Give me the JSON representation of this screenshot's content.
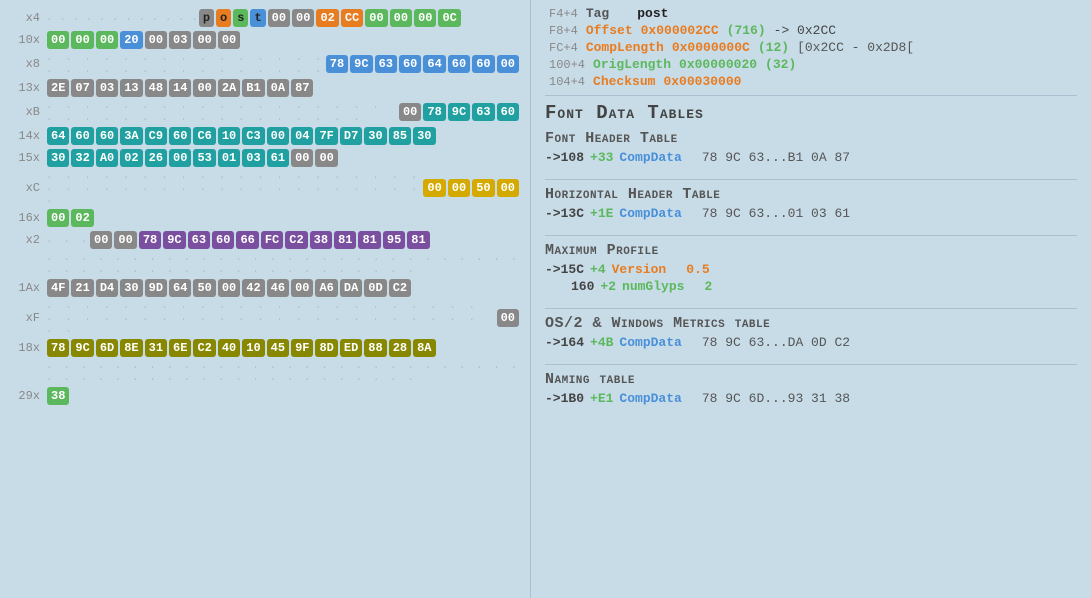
{
  "left": {
    "rows": [
      {
        "label": "x4",
        "prefix_dots": true,
        "cells": [
          {
            "val": "p",
            "cls": "post-p"
          },
          {
            "val": "o",
            "cls": "post-o"
          },
          {
            "val": "s",
            "cls": "post-s"
          },
          {
            "val": "t",
            "cls": "post-t"
          },
          {
            "val": "00",
            "cls": "hc-gray"
          },
          {
            "val": "00",
            "cls": "hc-gray"
          },
          {
            "val": "02",
            "cls": "hc-orange"
          },
          {
            "val": "CC",
            "cls": "hc-orange"
          },
          {
            "val": "00",
            "cls": "hc-green"
          },
          {
            "val": "00",
            "cls": "hc-green"
          },
          {
            "val": "00",
            "cls": "hc-green"
          },
          {
            "val": "0C",
            "cls": "hc-green"
          }
        ]
      },
      {
        "label": "10x",
        "prefix_dots": false,
        "cells": [
          {
            "val": "00",
            "cls": "hc-green"
          },
          {
            "val": "00",
            "cls": "hc-green"
          },
          {
            "val": "00",
            "cls": "hc-green"
          },
          {
            "val": "20",
            "cls": "hc-blue"
          },
          {
            "val": "00",
            "cls": "hc-gray"
          },
          {
            "val": "03",
            "cls": "hc-gray"
          },
          {
            "val": "00",
            "cls": "hc-gray"
          },
          {
            "val": "00",
            "cls": "hc-gray"
          }
        ]
      },
      {
        "label": "x8",
        "prefix_dots": true,
        "prefix_long": true,
        "cells": [
          {
            "val": "78",
            "cls": "hc-blue"
          },
          {
            "val": "9C",
            "cls": "hc-blue"
          },
          {
            "val": "63",
            "cls": "hc-blue"
          },
          {
            "val": "60",
            "cls": "hc-blue"
          },
          {
            "val": "64",
            "cls": "hc-blue"
          },
          {
            "val": "60",
            "cls": "hc-blue"
          },
          {
            "val": "60",
            "cls": "hc-blue"
          },
          {
            "val": "00",
            "cls": "hc-blue"
          }
        ]
      },
      {
        "label": "13x",
        "prefix_dots": false,
        "cells": [
          {
            "val": "2E",
            "cls": "hc-gray"
          },
          {
            "val": "07",
            "cls": "hc-gray"
          },
          {
            "val": "03",
            "cls": "hc-gray"
          },
          {
            "val": "13",
            "cls": "hc-gray"
          },
          {
            "val": "48",
            "cls": "hc-gray"
          },
          {
            "val": "14",
            "cls": "hc-gray"
          },
          {
            "val": "00",
            "cls": "hc-gray"
          },
          {
            "val": "2A",
            "cls": "hc-gray"
          },
          {
            "val": "B1",
            "cls": "hc-gray"
          },
          {
            "val": "0A",
            "cls": "hc-gray"
          },
          {
            "val": "87",
            "cls": "hc-gray"
          }
        ]
      },
      {
        "label": "xB",
        "prefix_dots": true,
        "prefix_long": true,
        "before_cells": [
          {
            "val": "00",
            "cls": "hc-gray"
          }
        ],
        "cells": [
          {
            "val": "78",
            "cls": "hc-teal"
          },
          {
            "val": "9C",
            "cls": "hc-teal"
          },
          {
            "val": "63",
            "cls": "hc-teal"
          },
          {
            "val": "60",
            "cls": "hc-teal"
          }
        ]
      },
      {
        "label": "14x",
        "prefix_dots": false,
        "cells": [
          {
            "val": "64",
            "cls": "hc-teal"
          },
          {
            "val": "60",
            "cls": "hc-teal"
          },
          {
            "val": "60",
            "cls": "hc-teal"
          },
          {
            "val": "3A",
            "cls": "hc-teal"
          },
          {
            "val": "C9",
            "cls": "hc-teal"
          },
          {
            "val": "60",
            "cls": "hc-teal"
          },
          {
            "val": "C6",
            "cls": "hc-teal"
          },
          {
            "val": "10",
            "cls": "hc-teal"
          },
          {
            "val": "C3",
            "cls": "hc-teal"
          },
          {
            "val": "00",
            "cls": "hc-teal"
          },
          {
            "val": "04",
            "cls": "hc-teal"
          },
          {
            "val": "7F",
            "cls": "hc-teal"
          },
          {
            "val": "D7",
            "cls": "hc-teal"
          },
          {
            "val": "30",
            "cls": "hc-teal"
          },
          {
            "val": "85",
            "cls": "hc-teal"
          },
          {
            "val": "30",
            "cls": "hc-teal"
          }
        ]
      },
      {
        "label": "15x",
        "prefix_dots": false,
        "cells": [
          {
            "val": "30",
            "cls": "hc-teal"
          },
          {
            "val": "32",
            "cls": "hc-teal"
          },
          {
            "val": "A0",
            "cls": "hc-teal"
          },
          {
            "val": "02",
            "cls": "hc-teal"
          },
          {
            "val": "26",
            "cls": "hc-teal"
          },
          {
            "val": "00",
            "cls": "hc-teal"
          },
          {
            "val": "53",
            "cls": "hc-teal"
          },
          {
            "val": "01",
            "cls": "hc-teal"
          },
          {
            "val": "03",
            "cls": "hc-teal"
          },
          {
            "val": "61",
            "cls": "hc-teal"
          },
          {
            "val": "00",
            "cls": "hc-gray"
          },
          {
            "val": "00",
            "cls": "hc-gray"
          }
        ]
      },
      {
        "label": "xC",
        "prefix_dots": true,
        "prefix_long": true,
        "cells": [
          {
            "val": "00",
            "cls": "hc-yellow"
          },
          {
            "val": "00",
            "cls": "hc-yellow"
          },
          {
            "val": "50",
            "cls": "hc-yellow"
          },
          {
            "val": "00",
            "cls": "hc-yellow"
          }
        ]
      },
      {
        "label": "16x",
        "prefix_dots": false,
        "cells": [
          {
            "val": "00",
            "cls": "hc-green"
          },
          {
            "val": "02",
            "cls": "hc-green"
          }
        ]
      },
      {
        "label": "x2",
        "prefix_dots": true,
        "cells": [
          {
            "val": "00",
            "cls": "hc-gray"
          },
          {
            "val": "00",
            "cls": "hc-gray"
          },
          {
            "val": "78",
            "cls": "hc-purple"
          },
          {
            "val": "9C",
            "cls": "hc-purple"
          },
          {
            "val": "63",
            "cls": "hc-purple"
          },
          {
            "val": "60",
            "cls": "hc-purple"
          },
          {
            "val": "66",
            "cls": "hc-purple"
          },
          {
            "val": "FC",
            "cls": "hc-purple"
          },
          {
            "val": "C2",
            "cls": "hc-purple"
          },
          {
            "val": "38",
            "cls": "hc-purple"
          },
          {
            "val": "81",
            "cls": "hc-purple"
          },
          {
            "val": "81",
            "cls": "hc-purple"
          },
          {
            "val": "95",
            "cls": "hc-purple"
          },
          {
            "val": "81",
            "cls": "hc-purple"
          }
        ]
      },
      {
        "label": "",
        "prefix_dots": false,
        "cells": []
      },
      {
        "label": "1Ax",
        "prefix_dots": false,
        "cells": [
          {
            "val": "4F",
            "cls": "hc-gray"
          },
          {
            "val": "21",
            "cls": "hc-gray"
          },
          {
            "val": "D4",
            "cls": "hc-gray"
          },
          {
            "val": "30",
            "cls": "hc-gray"
          },
          {
            "val": "9D",
            "cls": "hc-gray"
          },
          {
            "val": "64",
            "cls": "hc-gray"
          },
          {
            "val": "50",
            "cls": "hc-gray"
          },
          {
            "val": "00",
            "cls": "hc-gray"
          },
          {
            "val": "42",
            "cls": "hc-gray"
          },
          {
            "val": "46",
            "cls": "hc-gray"
          },
          {
            "val": "00",
            "cls": "hc-gray"
          },
          {
            "val": "A6",
            "cls": "hc-gray"
          },
          {
            "val": "DA",
            "cls": "hc-gray"
          },
          {
            "val": "0D",
            "cls": "hc-gray"
          },
          {
            "val": "C2",
            "cls": "hc-gray"
          }
        ]
      },
      {
        "label": "xF",
        "prefix_dots": true,
        "prefix_long": true,
        "end_cells": [
          {
            "val": "00",
            "cls": "hc-gray"
          }
        ],
        "cells": []
      },
      {
        "label": "18x",
        "prefix_dots": false,
        "cells": [
          {
            "val": "78",
            "cls": "hc-olive"
          },
          {
            "val": "9C",
            "cls": "hc-olive"
          },
          {
            "val": "6D",
            "cls": "hc-olive"
          },
          {
            "val": "8E",
            "cls": "hc-olive"
          },
          {
            "val": "31",
            "cls": "hc-olive"
          },
          {
            "val": "6E",
            "cls": "hc-olive"
          },
          {
            "val": "C2",
            "cls": "hc-olive"
          },
          {
            "val": "40",
            "cls": "hc-olive"
          },
          {
            "val": "10",
            "cls": "hc-olive"
          },
          {
            "val": "45",
            "cls": "hc-olive"
          },
          {
            "val": "9F",
            "cls": "hc-olive"
          },
          {
            "val": "8D",
            "cls": "hc-olive"
          },
          {
            "val": "ED",
            "cls": "hc-olive"
          },
          {
            "val": "88",
            "cls": "hc-olive"
          },
          {
            "val": "28",
            "cls": "hc-olive"
          },
          {
            "val": "8A",
            "cls": "hc-olive"
          }
        ]
      },
      {
        "label": "",
        "prefix_dots": false,
        "cells": []
      },
      {
        "label": "29x",
        "prefix_dots": false,
        "cells": [
          {
            "val": "38",
            "cls": "hc-green"
          }
        ]
      }
    ]
  },
  "right": {
    "meta_rows": [
      {
        "offset": "F4+4",
        "field": "Tag",
        "field_cls": "plain",
        "val": "post",
        "val_cls": "plain"
      },
      {
        "offset": "F8+4",
        "field": "Offset",
        "field_cls": "orange",
        "val": "0x000002CC",
        "extra": "(716)",
        "arrow": "-> 0x2CC",
        "val_cls": "orange"
      },
      {
        "offset": "FC+4",
        "field": "CompLength",
        "field_cls": "orange",
        "val": "0x0000000C",
        "extra": "(12)",
        "arrow": "[0x2CC - 0x2D8[",
        "val_cls": "orange"
      },
      {
        "offset": "100+4",
        "field": "OrigLength",
        "field_cls": "green",
        "val": "0x00000020",
        "extra": "(32)",
        "arrow": "",
        "val_cls": "green"
      },
      {
        "offset": "104+4",
        "field": "Checksum",
        "field_cls": "orange",
        "val": "0x00030000",
        "extra": "",
        "arrow": "",
        "val_cls": "orange"
      }
    ],
    "section_title": "Font Data Tables",
    "tables": [
      {
        "title": "Font Header Table",
        "rows": [
          {
            "arrow": "->108",
            "plus": "+33",
            "field": "CompData",
            "field_cls": "blue",
            "val": "78 9C 63...B1 0A 87",
            "val_cls": "val"
          }
        ]
      },
      {
        "title": "Horizontal Header Table",
        "rows": [
          {
            "arrow": "->13C",
            "plus": "+1E",
            "field": "CompData",
            "field_cls": "blue",
            "val": "78 9C 63...01 03 61",
            "val_cls": "val"
          }
        ]
      },
      {
        "title": "Maximum Profile",
        "rows": [
          {
            "arrow": "->15C",
            "plus": "+4",
            "field": "Version",
            "field_cls": "orange",
            "val": "0.5",
            "val_cls": "orange"
          },
          {
            "arrow": "160",
            "plus": "+2",
            "field": "numGlyps",
            "field_cls": "green",
            "val": "2",
            "val_cls": "green"
          }
        ]
      },
      {
        "title": "OS/2 & Windows Metrics table",
        "rows": [
          {
            "arrow": "->164",
            "plus": "+4B",
            "field": "CompData",
            "field_cls": "blue",
            "val": "78 9C 63...DA 0D C2",
            "val_cls": "val"
          }
        ]
      },
      {
        "title": "Naming table",
        "rows": [
          {
            "arrow": "->1B0",
            "plus": "+E1",
            "field": "CompData",
            "field_cls": "blue",
            "val": "78 9C 6D...93 31 38",
            "val_cls": "val"
          }
        ]
      }
    ]
  }
}
